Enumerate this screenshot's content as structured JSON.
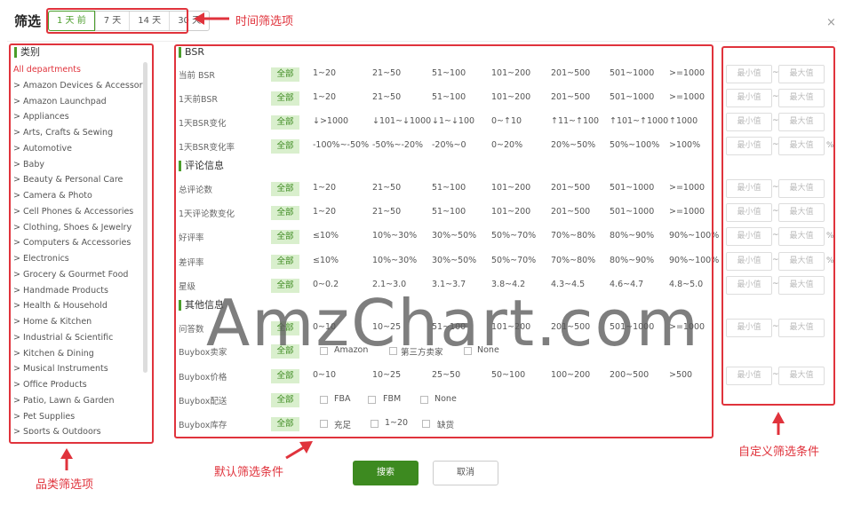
{
  "dialog": {
    "title": "筛选",
    "close_icon": "×"
  },
  "time_tabs": [
    "1 天 前",
    "7 天",
    "14 天",
    "30 天"
  ],
  "active_time_tab": 0,
  "annotations": {
    "time_filter": "时间筛选项",
    "category_filter": "品类筛选项",
    "default_filter": "默认筛选条件",
    "custom_filter": "自定义筛选条件"
  },
  "categories": {
    "header": "类别",
    "items": [
      "All departments",
      "> Amazon Devices & Accessories",
      "> Amazon Launchpad",
      "> Appliances",
      "> Arts, Crafts & Sewing",
      "> Automotive",
      "> Baby",
      "> Beauty & Personal Care",
      "> Camera & Photo",
      "> Cell Phones & Accessories",
      "> Clothing, Shoes & Jewelry",
      "> Computers & Accessories",
      "> Electronics",
      "> Grocery & Gourmet Food",
      "> Handmade Products",
      "> Health & Household",
      "> Home & Kitchen",
      "> Industrial & Scientific",
      "> Kitchen & Dining",
      "> Musical Instruments",
      "> Office Products",
      "> Patio, Lawn & Garden",
      "> Pet Supplies",
      "> Sports & Outdoors"
    ]
  },
  "all_label": "全部",
  "sections": {
    "bsr": "BSR",
    "reviews": "评论信息",
    "other": "其他信息"
  },
  "rows": {
    "current_bsr": {
      "label": "当前 BSR",
      "options": [
        "1~20",
        "21~50",
        "51~100",
        "101~200",
        "201~500",
        "501~1000",
        ">=1000"
      ]
    },
    "bsr_1d_ago": {
      "label": "1天前BSR",
      "options": [
        "1~20",
        "21~50",
        "51~100",
        "101~200",
        "201~500",
        "501~1000",
        ">=1000"
      ]
    },
    "bsr_1d_change": {
      "label": "1天BSR变化",
      "options": [
        "↓>1000",
        "↓101~↓1000",
        "↓1~↓100",
        "0~↑10",
        "↑11~↑100",
        "↑101~↑1000",
        "↑1000"
      ]
    },
    "bsr_1d_change_rate": {
      "label": "1天BSR变化率",
      "options": [
        "-100%~-50%",
        "-50%~-20%",
        "-20%~0",
        "0~20%",
        "20%~50%",
        "50%~100%",
        ">100%"
      ]
    },
    "total_reviews": {
      "label": "总评论数",
      "options": [
        "1~20",
        "21~50",
        "51~100",
        "101~200",
        "201~500",
        "501~1000",
        ">=1000"
      ]
    },
    "reviews_1d_change": {
      "label": "1天评论数变化",
      "options": [
        "1~20",
        "21~50",
        "51~100",
        "101~200",
        "201~500",
        "501~1000",
        ">=1000"
      ]
    },
    "positive_rate": {
      "label": "好评率",
      "options": [
        "≤10%",
        "10%~30%",
        "30%~50%",
        "50%~70%",
        "70%~80%",
        "80%~90%",
        "90%~100%"
      ]
    },
    "negative_rate": {
      "label": "差评率",
      "options": [
        "≤10%",
        "10%~30%",
        "30%~50%",
        "50%~70%",
        "70%~80%",
        "80%~90%",
        "90%~100%"
      ]
    },
    "rating": {
      "label": "星级",
      "options": [
        "0~0.2",
        "2.1~3.0",
        "3.1~3.7",
        "3.8~4.2",
        "4.3~4.5",
        "4.6~4.7",
        "4.8~5.0"
      ]
    },
    "qa_count": {
      "label": "问答数",
      "options": [
        "0~10",
        "10~25",
        "51~100",
        "101~200",
        "201~500",
        "501~1000",
        ">=1000"
      ]
    },
    "buybox_seller": {
      "label": "Buybox卖家",
      "options": [
        "Amazon",
        "第三方卖家",
        "None"
      ]
    },
    "buybox_price": {
      "label": "Buybox价格",
      "options": [
        "0~10",
        "10~25",
        "25~50",
        "50~100",
        "100~200",
        "200~500",
        ">500"
      ]
    },
    "buybox_fulfillment": {
      "label": "Buybox配送",
      "options": [
        "FBA",
        "FBM",
        "None"
      ]
    },
    "buybox_stock": {
      "label": "Buybox库存",
      "options": [
        "充足",
        "1~20",
        "缺货"
      ]
    }
  },
  "custom": {
    "min_placeholder": "最小值",
    "max_placeholder": "最大值",
    "tilde": "~",
    "percent": "%"
  },
  "watermark": "AmzChart.com",
  "buttons": {
    "search": "搜索",
    "cancel": "取消"
  },
  "colors": {
    "accent_green": "#3d8a20",
    "annotation_red": "#e0333c",
    "all_btn_bg": "#d9efcd"
  }
}
